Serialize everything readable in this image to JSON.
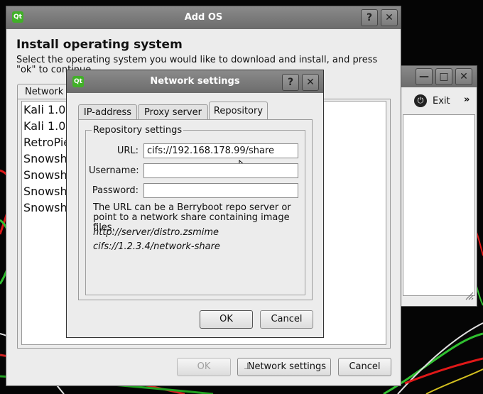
{
  "colors": {
    "qt_green": "#41b028",
    "dialog_bg": "#ececec",
    "titlebar": "#7a7a7a"
  },
  "back_window": {
    "exit_label": "Exit",
    "more_glyph": "»",
    "minimize_glyph": "—",
    "maximize_glyph": "□",
    "close_glyph": "✕"
  },
  "add_os": {
    "title": "Add OS",
    "logo_text": "Qt",
    "help_glyph": "?",
    "close_glyph": "✕",
    "heading": "Install operating system",
    "description": "Select the operating system you would like to download and install, and press \"ok\" to continue.",
    "tab_label": "Network s",
    "os_list": [
      "Kali 1.0.",
      "Kali 1.0.",
      "RetroPie",
      "Snowsh",
      "Snowsh",
      "Snowsh",
      "Snowsh"
    ],
    "ok_label": "OK",
    "network_settings_label": "Network settings",
    "cancel_label": "Cancel"
  },
  "network_dialog": {
    "title": "Network settings",
    "logo_text": "Qt",
    "help_glyph": "?",
    "close_glyph": "✕",
    "tabs": [
      "IP-address",
      "Proxy server",
      "Repository"
    ],
    "active_tab": "Repository",
    "group_title": "Repository settings",
    "url_label": "URL:",
    "url_value": "cifs://192.168.178.99/share",
    "username_label": "Username:",
    "username_value": "",
    "password_label": "Password:",
    "password_value": "",
    "help_text": "The URL can be a Berryboot repo server or point to a network share containing image files.",
    "example1": "http://server/distro.zsmime",
    "example2": "cifs://1.2.3.4/network-share",
    "ok_label": "OK",
    "cancel_label": "Cancel"
  }
}
